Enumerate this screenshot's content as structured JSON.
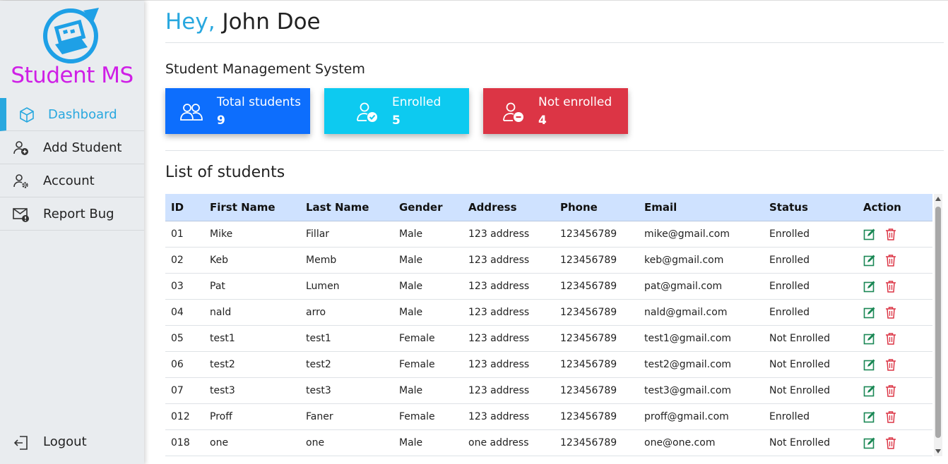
{
  "sidebar": {
    "logo_text": "Student MS",
    "items": [
      {
        "label": "Dashboard",
        "icon": "cube-icon",
        "active": true
      },
      {
        "label": "Add Student",
        "icon": "person-plus-icon"
      },
      {
        "label": "Account",
        "icon": "person-gear-icon"
      },
      {
        "label": "Report Bug",
        "icon": "envelope-exclamation-icon"
      }
    ],
    "logout_label": "Logout"
  },
  "header": {
    "greeting": "Hey,",
    "user_name": "John Doe"
  },
  "subtitle": "Student Management System",
  "cards": [
    {
      "label": "Total students",
      "value": "9",
      "color": "#0d6efd",
      "icon": "people-icon"
    },
    {
      "label": "Enrolled",
      "value": "5",
      "color": "#0dcaf0",
      "icon": "person-check-icon"
    },
    {
      "label": "Not enrolled",
      "value": "4",
      "color": "#dc3545",
      "icon": "person-dash-icon"
    }
  ],
  "list_title": "List of students",
  "table": {
    "headers": [
      "ID",
      "First Name",
      "Last Name",
      "Gender",
      "Address",
      "Phone",
      "Email",
      "Status",
      "Action"
    ],
    "rows": [
      [
        "01",
        "Mike",
        "Fillar",
        "Male",
        "123 address",
        "123456789",
        "mike@gmail.com",
        "Enrolled"
      ],
      [
        "02",
        "Keb",
        "Memb",
        "Male",
        "123 address",
        "123456789",
        "keb@gmail.com",
        "Enrolled"
      ],
      [
        "03",
        "Pat",
        "Lumen",
        "Male",
        "123 address",
        "123456789",
        "pat@gmail.com",
        "Enrolled"
      ],
      [
        "04",
        "nald",
        "arro",
        "Male",
        "123 address",
        "123456789",
        "nald@gmail.com",
        "Enrolled"
      ],
      [
        "05",
        "test1",
        "test1",
        "Female",
        "123 address",
        "123456789",
        "test1@gmail.com",
        "Not Enrolled"
      ],
      [
        "06",
        "test2",
        "test2",
        "Female",
        "123 address",
        "123456789",
        "test2@gmail.com",
        "Not Enrolled"
      ],
      [
        "07",
        "test3",
        "test3",
        "Male",
        "123 address",
        "123456789",
        "test3@gmail.com",
        "Not Enrolled"
      ],
      [
        "012",
        "Proff",
        "Faner",
        "Female",
        "123 address",
        "123456789",
        "proff@gmail.com",
        "Enrolled"
      ],
      [
        "018",
        "one",
        "one",
        "Male",
        "one address",
        "123456789",
        "one@one.com",
        "Not Enrolled"
      ]
    ]
  },
  "colors": {
    "accent": "#29a8df",
    "brand": "#cf1fe6",
    "edit": "#198754",
    "delete": "#dc3545"
  }
}
